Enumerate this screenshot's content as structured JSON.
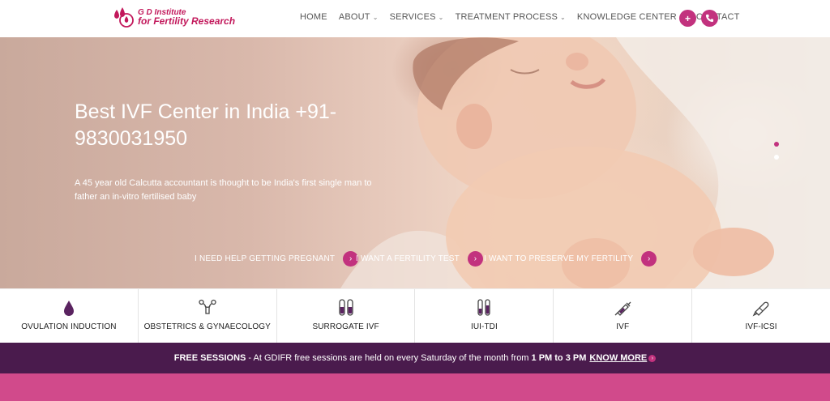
{
  "header": {
    "logo": {
      "line1": "G D Institute",
      "line2": "for Fertility Research"
    },
    "nav": [
      {
        "label": "HOME",
        "dropdown": false
      },
      {
        "label": "ABOUT",
        "dropdown": true
      },
      {
        "label": "SERVICES",
        "dropdown": true
      },
      {
        "label": "TREATMENT PROCESS",
        "dropdown": true
      },
      {
        "label": "KNOWLEDGE CENTER",
        "dropdown": true
      },
      {
        "label": "CONTACT",
        "dropdown": false
      }
    ],
    "buttons": {
      "plus_icon": "+",
      "phone_icon": "✆"
    }
  },
  "hero": {
    "title": "Best IVF Center in India +91-9830031950",
    "subtitle": "A 45 year old Calcutta accountant is thought to be India's first single man to father an in-vitro fertilised baby",
    "ctas": [
      "I NEED HELP GETTING PREGNANT",
      "I WANT A FERTILITY TEST",
      "I WANT TO PRESERVE MY FERTILITY"
    ],
    "arrow_icon": "›",
    "slider_dots": {
      "active": "#c2327e",
      "inactive": "#ffffff"
    }
  },
  "services": [
    {
      "label": "OVULATION INDUCTION",
      "icon": "drop-icon"
    },
    {
      "label": "OBSTETRICS & GYNAECOLOGY",
      "icon": "uterus-icon"
    },
    {
      "label": "SURROGATE IVF",
      "icon": "test-tubes-icon"
    },
    {
      "label": "IUI-TDI",
      "icon": "test-tubes-icon"
    },
    {
      "label": "IVF",
      "icon": "syringe-icon"
    },
    {
      "label": "IVF-ICSI",
      "icon": "pipette-icon"
    }
  ],
  "free_sessions": {
    "heading": "FREE SESSIONS",
    "text": " - At GDIFR free sessions are held on every Saturday of the month from ",
    "time": "1 PM to 3 PM",
    "link": "KNOW MORE",
    "link_icon": "›"
  },
  "colors": {
    "brand": "#c2327e",
    "dark_bar": "#4a1b4d",
    "pink_band": "#d14a8b"
  }
}
